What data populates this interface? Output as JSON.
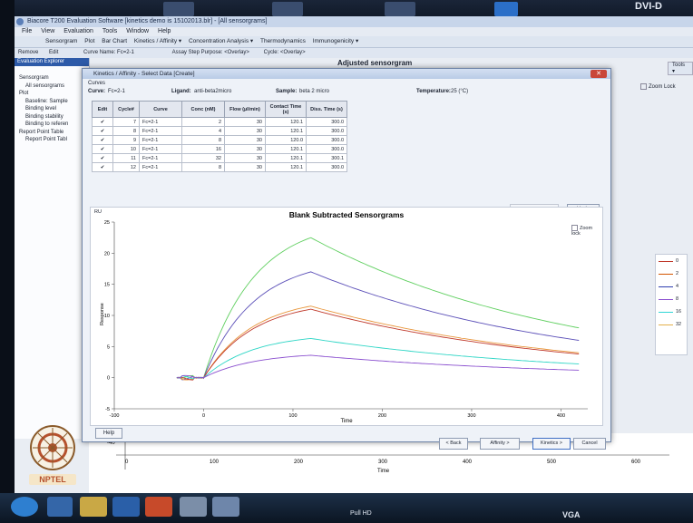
{
  "screen_label": "DVI-D",
  "bottom_labels": {
    "left": "Pull HD",
    "right": "VGA"
  },
  "app": {
    "title": "Biacore T200 Evaluation Software [kinetics demo is 15102013.blr] - [All sensorgrams]",
    "menu": [
      "File",
      "View",
      "Evaluation",
      "Tools",
      "Window",
      "Help"
    ],
    "toolbar": [
      "Sensorgram",
      "Plot",
      "Bar Chart",
      "Kinetics / Affinity ▾",
      "Concentration Analysis ▾",
      "Thermodynamics",
      "Immunogenicity ▾"
    ],
    "toolbar2": {
      "remove": "Remove",
      "edit": "Edit",
      "curve_name": "Curve Name: Fc=2-1",
      "assay_step": "Assay Step Purpose: <Overlay>",
      "cycle": "Cycle: <Overlay>"
    },
    "background_chart_title": "Adjusted sensorgram",
    "tools_label": "Tools ▾",
    "zoom_lock": "Zoom Lock"
  },
  "explorer": {
    "header": "Evaluation Explorer",
    "items": [
      "Sensorgram",
      "All sensorgrams",
      "Plot",
      "Baseline: Sample",
      "Binding level",
      "Binding stability",
      "Binding to referen",
      "Report Point Table",
      "Report Point Tabl"
    ]
  },
  "dialog": {
    "title": "Kinetics / Affinity - Select Data [Create]",
    "close": "✕",
    "curves_label": "Curves",
    "curve": {
      "label": "Curve:",
      "value": "Fc=2-1"
    },
    "ligand": {
      "label": "Ligand:",
      "value": "anti-beta2micro"
    },
    "sample": {
      "label": "Sample:",
      "value": "beta 2 micro"
    },
    "temperature": {
      "label": "Temperature:",
      "value": "25 (°C)"
    },
    "table": {
      "headers": [
        "Edit",
        "Cycle#",
        "Curve",
        "Conc (nM)",
        "Flow (µl/min)",
        "Contact Time (s)",
        "Diss. Time (s)"
      ],
      "rows": [
        [
          "✔",
          "7",
          "Fc=2-1",
          "2",
          "30",
          "120.1",
          "300.0"
        ],
        [
          "✔",
          "8",
          "Fc=2-1",
          "4",
          "30",
          "120.1",
          "300.0"
        ],
        [
          "✔",
          "9",
          "Fc=2-1",
          "8",
          "30",
          "120.0",
          "300.0"
        ],
        [
          "✔",
          "10",
          "Fc=2-1",
          "16",
          "30",
          "120.1",
          "300.0"
        ],
        [
          "✔",
          "11",
          "Fc=2-1",
          "32",
          "30",
          "120.1",
          "300.1"
        ],
        [
          "✔",
          "12",
          "Fc=2-1",
          "8",
          "30",
          "120.1",
          "300.0"
        ]
      ]
    },
    "remove_selection": "Remove Selection",
    "undo": "Undo",
    "zoom_lock": "Zoom lock",
    "help": "Help",
    "buttons": {
      "back": "< Back",
      "affinity": "Affinity >",
      "kinetics": "Kinetics >",
      "cancel": "Cancel"
    }
  },
  "legend": {
    "items": [
      {
        "label": "0",
        "color": "#c0392b"
      },
      {
        "label": "2",
        "color": "#d35400"
      },
      {
        "label": "4",
        "color": "#2e3eb0"
      },
      {
        "label": "8",
        "color": "#8a4fcf"
      },
      {
        "label": "16",
        "color": "#2fd6d6"
      },
      {
        "label": "32",
        "color": "#e3b04b"
      }
    ]
  },
  "background_axis": {
    "ticks": [
      "0",
      "100",
      "200",
      "300",
      "400",
      "500",
      "600"
    ],
    "y_tick": "-40",
    "xlabel": "Time"
  },
  "chart_data": {
    "type": "line",
    "title": "Blank Subtracted Sensorgrams",
    "ylabel_top": "RU",
    "ylabel": "Response",
    "xlabel": "Time",
    "xlim": [
      -100,
      430
    ],
    "ylim": [
      -5,
      25
    ],
    "xticks": [
      -100,
      0,
      100,
      200,
      300,
      400
    ],
    "yticks": [
      -5,
      0,
      5,
      10,
      15,
      20,
      25
    ],
    "assoc_end": 120,
    "series": [
      {
        "color": "#5fcf5f",
        "peak": 22.5,
        "end": 8.0
      },
      {
        "color": "#5b4fb8",
        "peak": 17.0,
        "end": 6.0
      },
      {
        "color": "#e8963c",
        "peak": 11.5,
        "end": 4.0
      },
      {
        "color": "#c0392b",
        "peak": 11.0,
        "end": 3.8
      },
      {
        "color": "#2fd6c6",
        "peak": 6.3,
        "end": 2.2
      },
      {
        "color": "#8a4fcf",
        "peak": 3.6,
        "end": 1.2
      }
    ]
  }
}
